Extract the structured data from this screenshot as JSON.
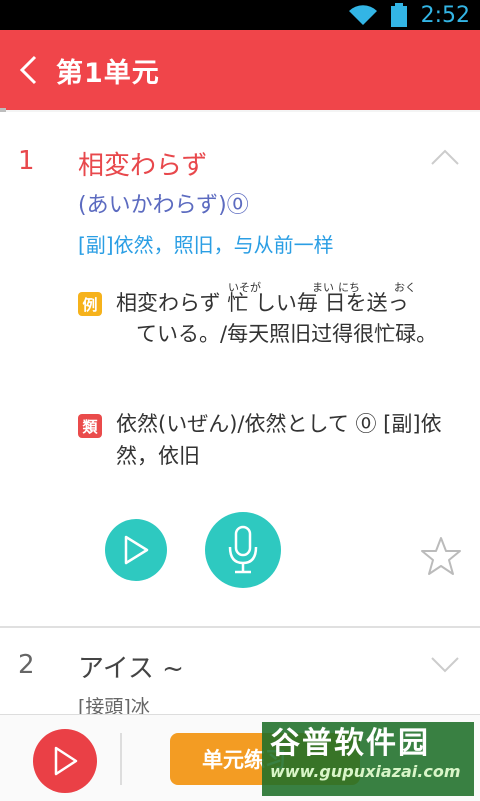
{
  "status_bar": {
    "time": "2:52"
  },
  "header": {
    "title": "第1单元"
  },
  "entries": [
    {
      "number": "1",
      "word": "相変わらず",
      "reading": "(あいかわらず)⓪",
      "meaning": "[副]依然，照旧，与从前一样",
      "example_badge": "例",
      "example_ruby": [
        "いそが",
        "まい",
        "にち",
        "おく"
      ],
      "example_first_line": "相変わらず 忙 しい毎 日を送っ",
      "example_rest": "ている。/每天照旧过得很忙碌。",
      "synonym_badge": "類",
      "synonym_text": "依然(いぜん)/依然として ⓪ [副]依然，依旧"
    },
    {
      "number": "2",
      "word": "アイス ~",
      "meaning": "[接頭]冰"
    }
  ],
  "bottom_bar": {
    "unit_button_label": "单元练习"
  },
  "watermark": {
    "line1": "谷普软件园",
    "line2": "www.gupuxiazai.com"
  },
  "colors": {
    "header_bg": "#f0454a",
    "accent_teal": "#2ec9c0",
    "example_badge": "#f6b21b",
    "synonym_badge": "#ea4b4b",
    "reading": "#5c6bc0",
    "meaning": "#2a9ee4"
  }
}
